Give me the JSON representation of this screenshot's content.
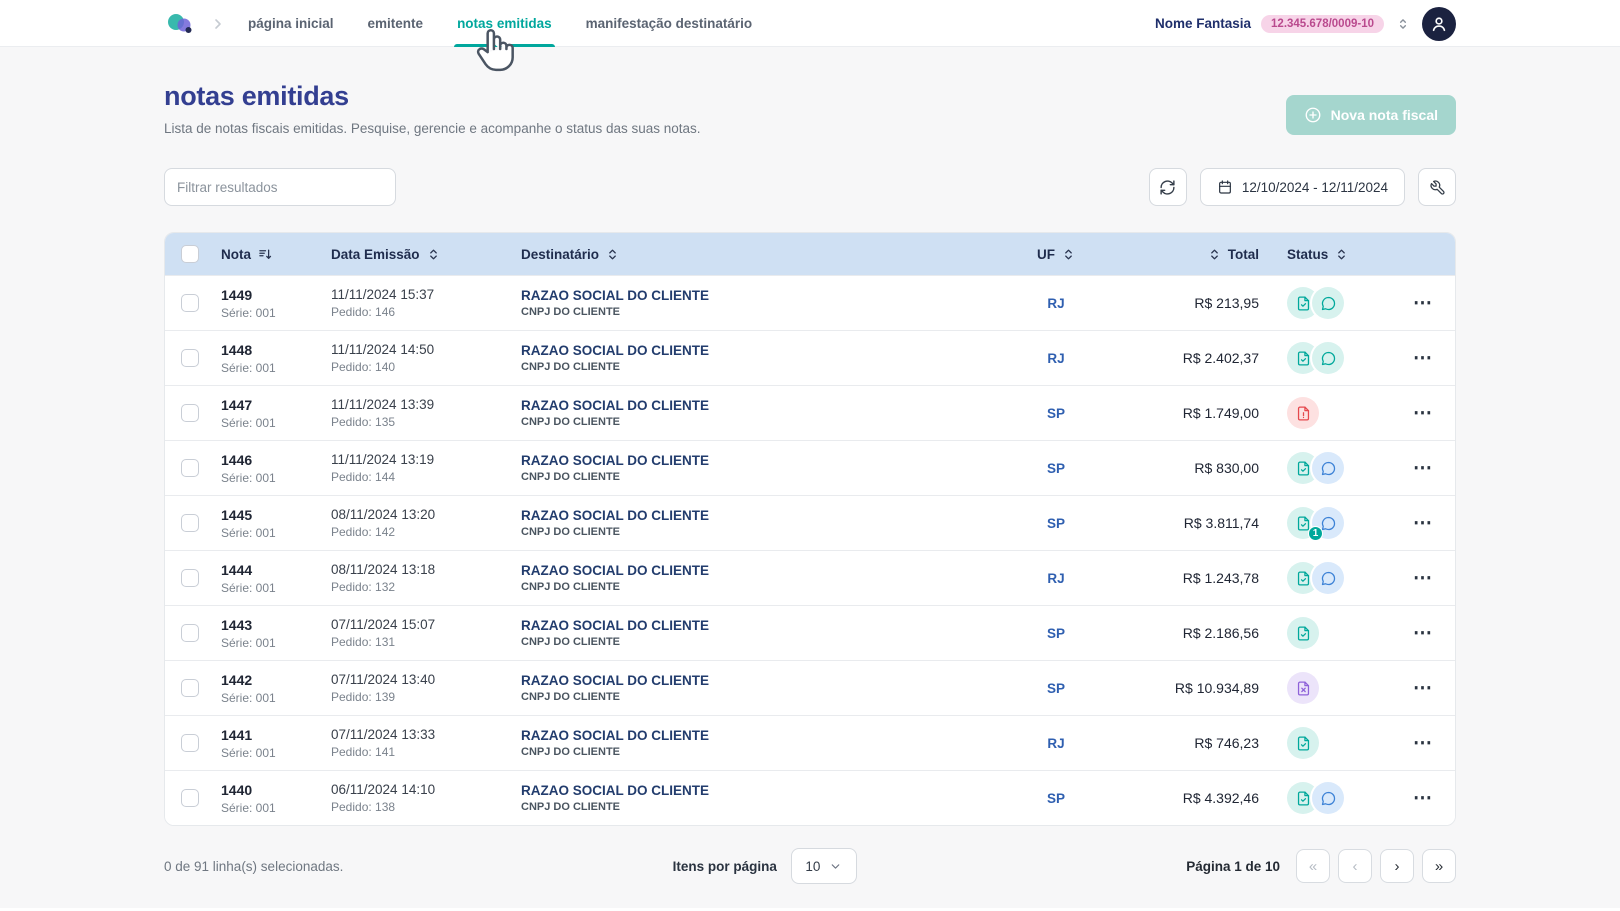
{
  "header": {
    "nav_items": [
      {
        "label": "página inicial"
      },
      {
        "label": "emitente"
      },
      {
        "label": "notas emitidas"
      },
      {
        "label": "manifestação destinatário"
      }
    ],
    "active_index": 2,
    "account": {
      "name": "Nome Fantasia",
      "cnpj": "12.345.678/0009-10"
    }
  },
  "page": {
    "title": "notas emitidas",
    "subtitle": "Lista de notas fiscais emitidas. Pesquise, gerencie e acompanhe o status das suas notas.",
    "new_button": "Nova nota fiscal"
  },
  "filters": {
    "search_placeholder": "Filtrar resultados",
    "date_range": "12/10/2024 - 12/11/2024"
  },
  "table": {
    "headers": {
      "nota": "Nota",
      "data": "Data Emissão",
      "dest": "Destinatário",
      "uf": "UF",
      "total": "Total",
      "status": "Status"
    },
    "rows": [
      {
        "nota": "1449",
        "serie": "Série: 001",
        "date": "11/11/2024 15:37",
        "pedido": "Pedido: 146",
        "dest_name": "RAZAO SOCIAL DO CLIENTE",
        "dest_doc": "CNPJ DO CLIENTE",
        "uf": "RJ",
        "total": "R$ 213,95",
        "status": [
          {
            "icon": "document-check",
            "color": "teal"
          },
          {
            "icon": "chat",
            "color": "teal"
          }
        ]
      },
      {
        "nota": "1448",
        "serie": "Série: 001",
        "date": "11/11/2024 14:50",
        "pedido": "Pedido: 140",
        "dest_name": "RAZAO SOCIAL DO CLIENTE",
        "dest_doc": "CNPJ DO CLIENTE",
        "uf": "RJ",
        "total": "R$ 2.402,37",
        "status": [
          {
            "icon": "document-check",
            "color": "teal"
          },
          {
            "icon": "chat",
            "color": "teal"
          }
        ]
      },
      {
        "nota": "1447",
        "serie": "Série: 001",
        "date": "11/11/2024 13:39",
        "pedido": "Pedido: 135",
        "dest_name": "RAZAO SOCIAL DO CLIENTE",
        "dest_doc": "CNPJ DO CLIENTE",
        "uf": "SP",
        "total": "R$ 1.749,00",
        "status": [
          {
            "icon": "document-alert",
            "color": "red"
          }
        ]
      },
      {
        "nota": "1446",
        "serie": "Série: 001",
        "date": "11/11/2024 13:19",
        "pedido": "Pedido: 144",
        "dest_name": "RAZAO SOCIAL DO CLIENTE",
        "dest_doc": "CNPJ DO CLIENTE",
        "uf": "SP",
        "total": "R$ 830,00",
        "status": [
          {
            "icon": "document-check",
            "color": "teal"
          },
          {
            "icon": "chat",
            "color": "blue"
          }
        ]
      },
      {
        "nota": "1445",
        "serie": "Série: 001",
        "date": "08/11/2024 13:20",
        "pedido": "Pedido: 142",
        "dest_name": "RAZAO SOCIAL DO CLIENTE",
        "dest_doc": "CNPJ DO CLIENTE",
        "uf": "SP",
        "total": "R$ 3.811,74",
        "status": [
          {
            "icon": "document-check",
            "color": "teal"
          },
          {
            "icon": "chat",
            "color": "blue",
            "badge": "1"
          }
        ]
      },
      {
        "nota": "1444",
        "serie": "Série: 001",
        "date": "08/11/2024 13:18",
        "pedido": "Pedido: 132",
        "dest_name": "RAZAO SOCIAL DO CLIENTE",
        "dest_doc": "CNPJ DO CLIENTE",
        "uf": "RJ",
        "total": "R$ 1.243,78",
        "status": [
          {
            "icon": "document-check",
            "color": "teal"
          },
          {
            "icon": "chat",
            "color": "blue"
          }
        ]
      },
      {
        "nota": "1443",
        "serie": "Série: 001",
        "date": "07/11/2024 15:07",
        "pedido": "Pedido: 131",
        "dest_name": "RAZAO SOCIAL DO CLIENTE",
        "dest_doc": "CNPJ DO CLIENTE",
        "uf": "SP",
        "total": "R$ 2.186,56",
        "status": [
          {
            "icon": "document-check",
            "color": "teal"
          }
        ]
      },
      {
        "nota": "1442",
        "serie": "Série: 001",
        "date": "07/11/2024 13:40",
        "pedido": "Pedido: 139",
        "dest_name": "RAZAO SOCIAL DO CLIENTE",
        "dest_doc": "CNPJ DO CLIENTE",
        "uf": "SP",
        "total": "R$ 10.934,89",
        "status": [
          {
            "icon": "document-x",
            "color": "purple"
          }
        ]
      },
      {
        "nota": "1441",
        "serie": "Série: 001",
        "date": "07/11/2024 13:33",
        "pedido": "Pedido: 141",
        "dest_name": "RAZAO SOCIAL DO CLIENTE",
        "dest_doc": "CNPJ DO CLIENTE",
        "uf": "RJ",
        "total": "R$ 746,23",
        "status": [
          {
            "icon": "document-check",
            "color": "teal"
          }
        ]
      },
      {
        "nota": "1440",
        "serie": "Série: 001",
        "date": "06/11/2024 14:10",
        "pedido": "Pedido: 138",
        "dest_name": "RAZAO SOCIAL DO CLIENTE",
        "dest_doc": "CNPJ DO CLIENTE",
        "uf": "SP",
        "total": "R$ 4.392,46",
        "status": [
          {
            "icon": "document-check",
            "color": "teal"
          },
          {
            "icon": "chat",
            "color": "blue"
          }
        ]
      }
    ]
  },
  "pagination": {
    "selection": "0 de 91 linha(s) selecionadas.",
    "per_page_label": "Itens por página",
    "per_page_value": "10",
    "page_info": "Página 1 de 10",
    "first": "«",
    "prev": "‹",
    "next": "›",
    "last": "»"
  },
  "icons": {
    "more_actions": "⋯"
  },
  "colors": {
    "accent_teal": "#00A79D",
    "title_indigo": "#333F91",
    "table_header_bg": "#CFE0F3",
    "badge_pink_bg": "#F7D4E8",
    "badge_pink_text": "#BA4A8E",
    "status_teal": "#00A89B",
    "status_blue": "#3C82D6",
    "status_red": "#E5484D",
    "status_purple": "#8E62D9",
    "new_button_bg": "#A5D6CE"
  }
}
